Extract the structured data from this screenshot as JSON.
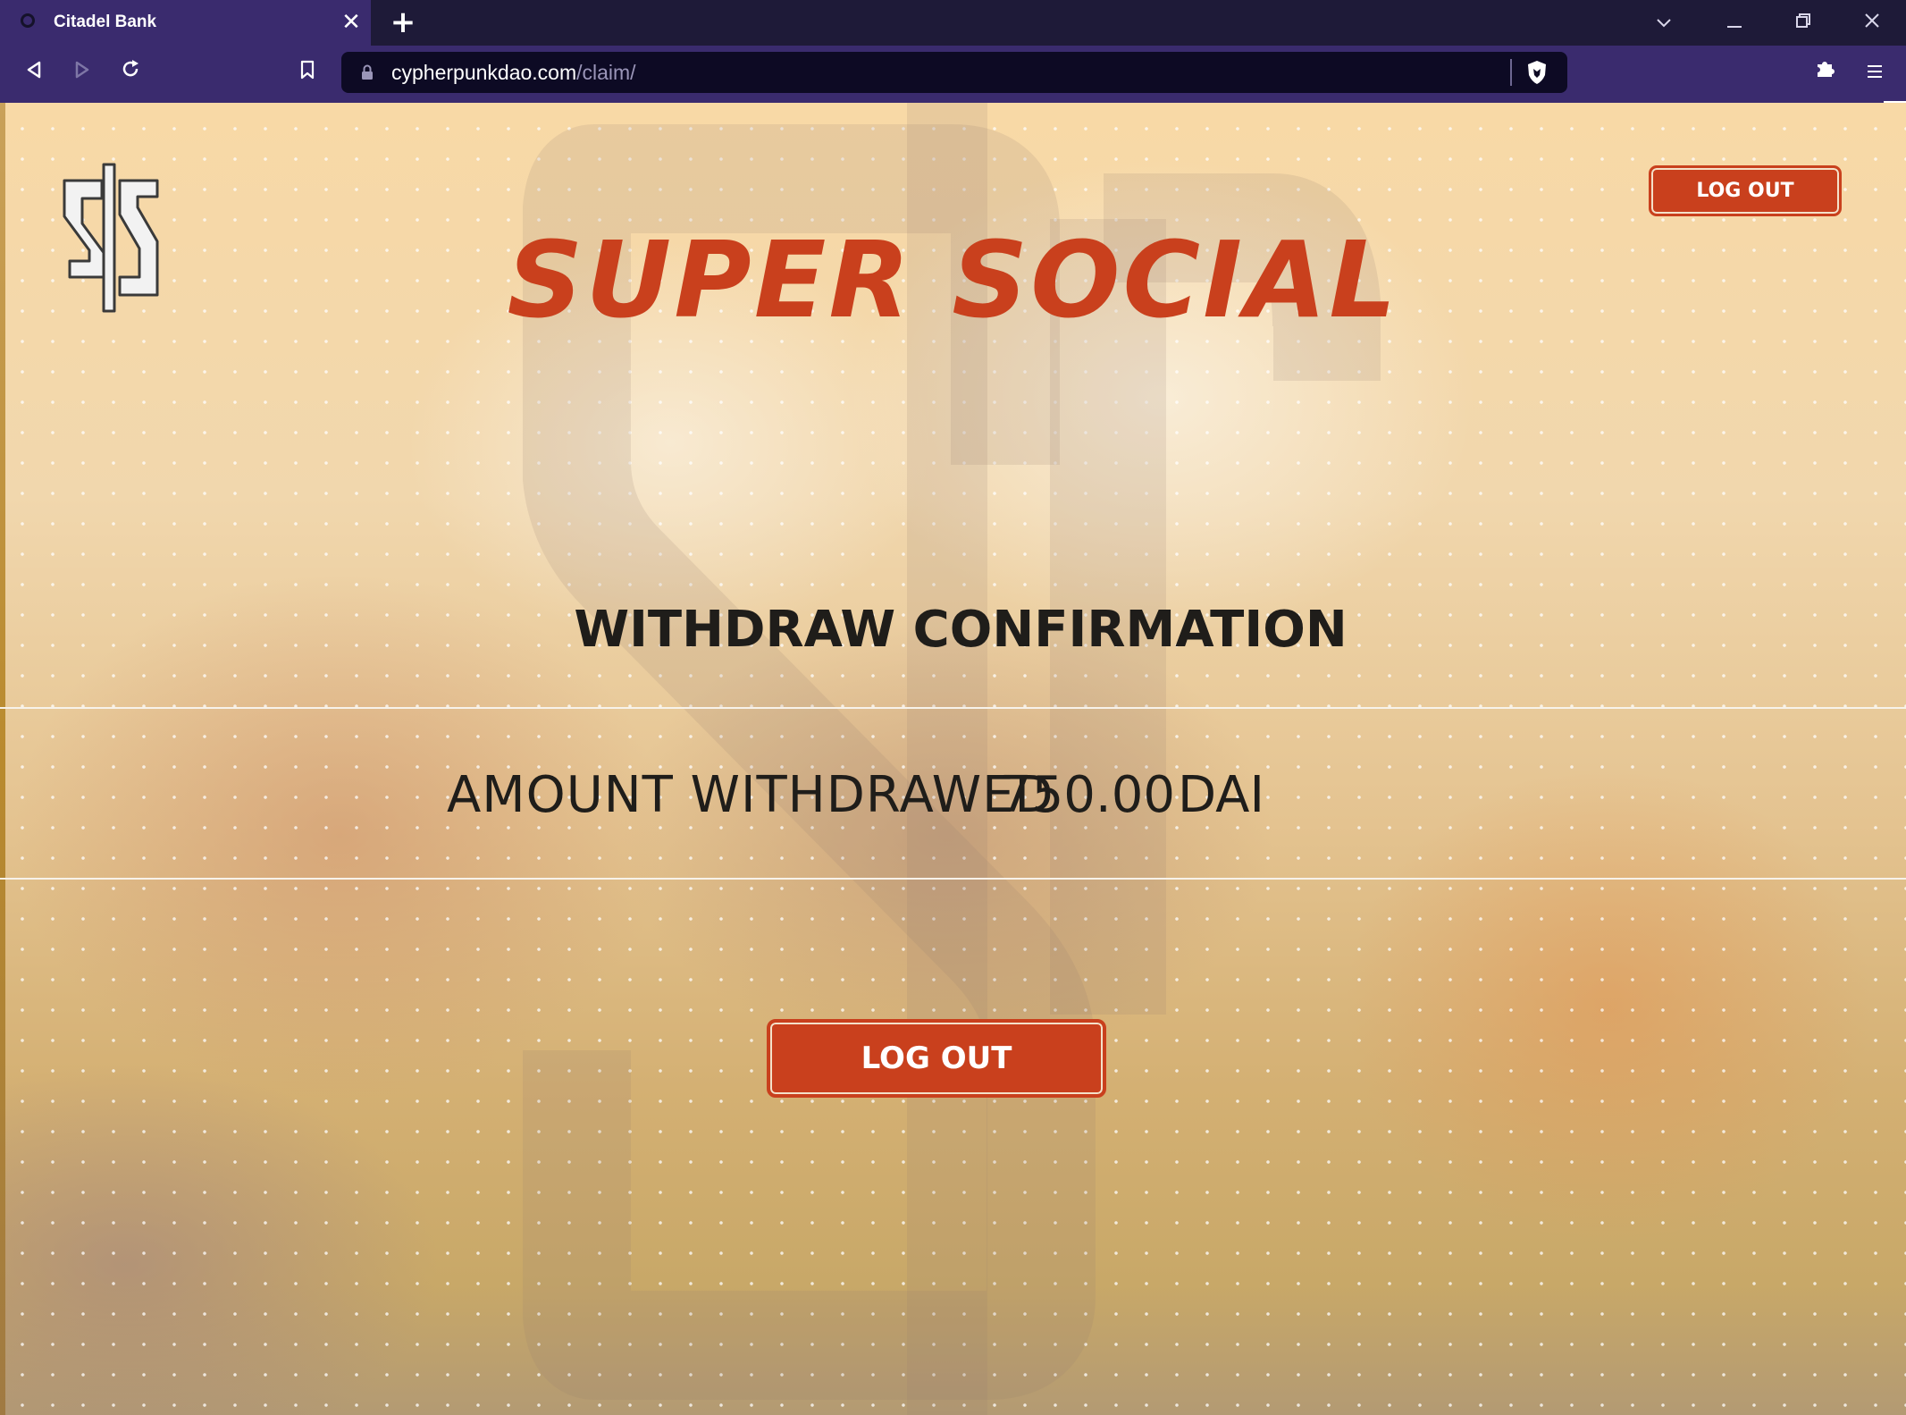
{
  "browser": {
    "tab_title": "Citadel Bank",
    "url_host": "cypherpunkdao.com",
    "url_path": "/claim/"
  },
  "header": {
    "logout_label": "LOG OUT"
  },
  "hero": {
    "title": "SUPER SOCIAL"
  },
  "confirmation": {
    "title": "WITHDRAW CONFIRMATION",
    "amount_label": "AMOUNT WITHDRAWED",
    "amount_value": "750.00",
    "amount_unit": "DAI"
  },
  "footer_action": {
    "logout_label": "LOG OUT"
  },
  "colors": {
    "accent": "#c9401d",
    "browser_frame": "#3a2b6e",
    "text_dark": "#1f1d1a"
  }
}
